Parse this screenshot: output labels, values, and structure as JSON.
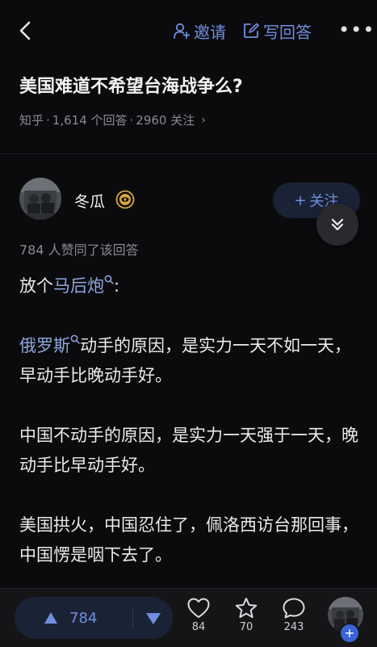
{
  "topbar": {
    "invite_label": "邀请",
    "write_label": "写回答",
    "more_label": "•••"
  },
  "question": {
    "title": "美国难道不希望台海战争么?",
    "source": "知乎",
    "sep1": "·",
    "answers": "1,614 个回答",
    "sep2": "·",
    "followers": "2960 关注",
    "arrow": "›"
  },
  "author": {
    "name": "冬瓜",
    "follow_label": "关注",
    "follow_plus": "+"
  },
  "answer": {
    "agree_line": "784 人赞同了该回答",
    "p1_prefix": "放个",
    "p1_keyword": "马后炮",
    "p1_suffix": ":",
    "p2_keyword": "俄罗斯",
    "p2_text": "动手的原因，是实力一天不如一天，早动手比晚动手好。",
    "p3_text": "中国不动手的原因，是实力一天强于一天，晚动手比早动手好。",
    "p4_text": "美国拱火，中国忍住了，佩洛西访台那回事，中国愣是咽下去了。"
  },
  "bottombar": {
    "upvotes": "784",
    "likes": "84",
    "favorites": "70",
    "comments": "243",
    "plus": "+"
  },
  "colors": {
    "accent": "#6f8fdf",
    "keyword": "#8fa6dc",
    "background": "#0b0b0e",
    "pill_bg": "#1a2236"
  },
  "icons": {
    "back": "chevron-left-icon",
    "invite": "user-plus-icon",
    "write": "edit-icon",
    "more": "more-icon",
    "badge": "eye-badge-icon",
    "collapse": "double-chevron-down-icon",
    "search": "search-icon",
    "upvote": "triangle-up-icon",
    "downvote": "triangle-down-icon",
    "like": "heart-icon",
    "favorite": "star-icon",
    "comment": "comment-icon"
  }
}
